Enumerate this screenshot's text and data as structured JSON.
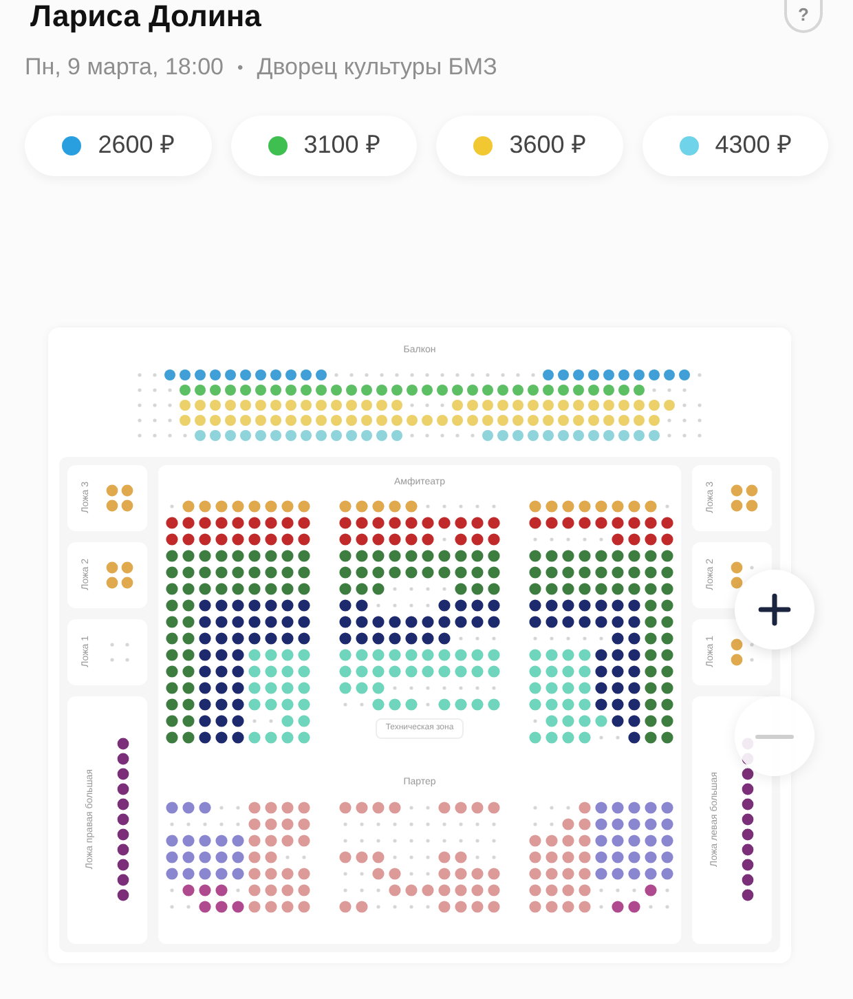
{
  "event": {
    "title": "Лариса Долина",
    "date": "Пн, 9 марта, 18:00",
    "separator": "•",
    "venue": "Дворец культуры БМЗ"
  },
  "help": {
    "label": "?"
  },
  "prices": [
    {
      "label": "2600 ₽",
      "color": "#2a9fe0"
    },
    {
      "label": "3100 ₽",
      "color": "#3fbf4f"
    },
    {
      "label": "3600 ₽",
      "color": "#f2c832"
    },
    {
      "label": "4300 ₽",
      "color": "#6fd3ea"
    }
  ],
  "hall": {
    "balcony": "Балкон",
    "amphitheater": "Амфитеатр",
    "parterre": "Партер",
    "tech_zone": "Техническая зона",
    "left_boxes": [
      "Ложа 3",
      "Ложа 2",
      "Ложа 1"
    ],
    "right_boxes": [
      "Ложа 3",
      "Ложа 2",
      "Ложа 1"
    ],
    "left_big_box": "Ложа правая большая",
    "right_big_box": "Ложа левая большая"
  }
}
